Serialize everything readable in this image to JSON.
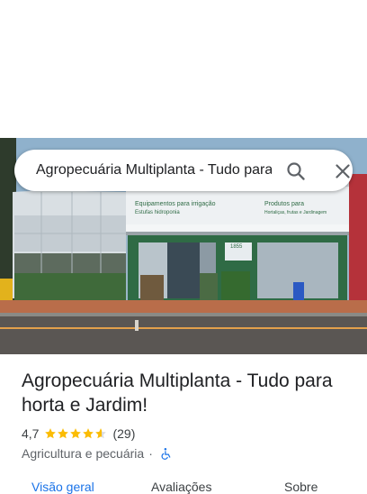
{
  "search": {
    "query": "Agropecuária Multiplanta - Tudo para horta e Jardim!",
    "search_icon": "search-icon",
    "close_icon": "close-icon"
  },
  "photo": {
    "sign_left": "Equipamentos para irrigação",
    "sign_left_2": "Estufas hidroponia",
    "sign_right": "Produtos para",
    "sign_right_2": "Hortaliças, frutas e Jardinagem",
    "building_number": "1855"
  },
  "place": {
    "title": "Agropecuária Multiplanta - Tudo para horta e Jardim!",
    "rating": "4,7",
    "stars": 4.7,
    "review_count": "(29)",
    "category": "Agricultura e pecuária",
    "separator": "·",
    "accessibility_icon": "wheelchair-icon"
  },
  "tabs": [
    {
      "label": "Visão geral",
      "active": true
    },
    {
      "label": "Avaliações",
      "active": false
    },
    {
      "label": "Sobre",
      "active": false
    }
  ],
  "colors": {
    "accent": "#1a73e8",
    "star": "#fbbc04",
    "store_green": "#2f6b45"
  }
}
